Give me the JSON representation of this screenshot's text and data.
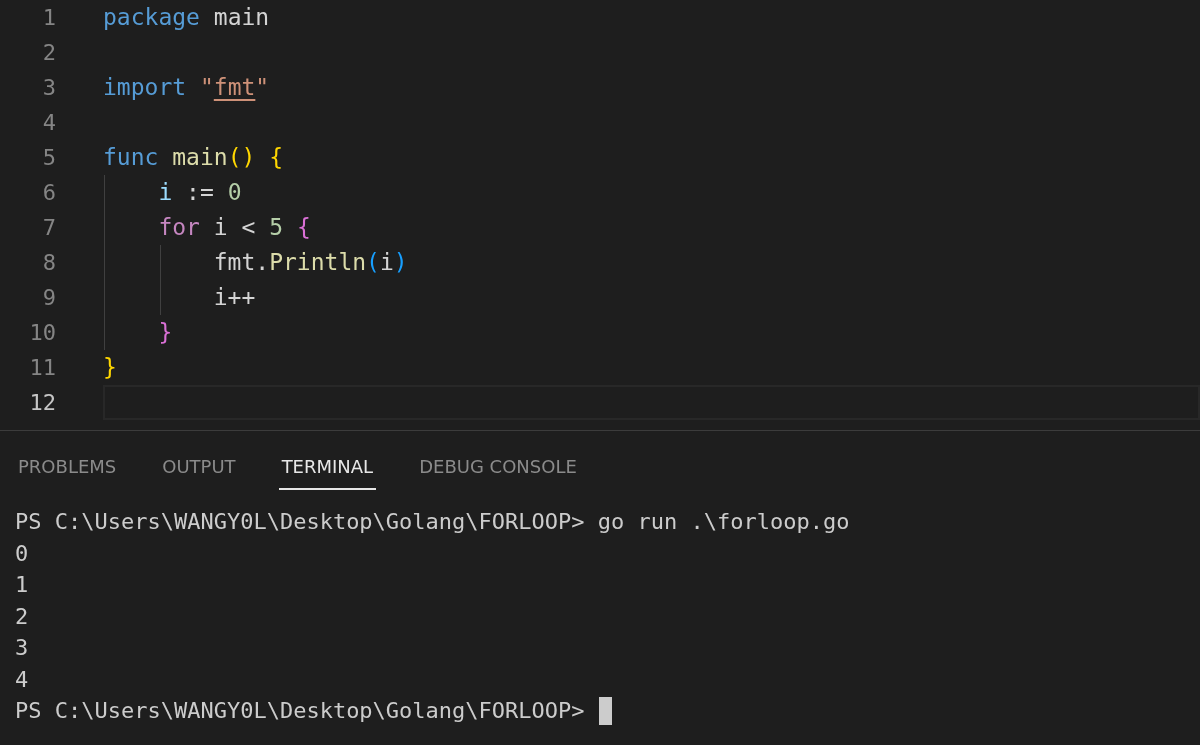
{
  "editor": {
    "lines": [
      {
        "number": "1",
        "current": false,
        "tokens": [
          {
            "text": "package",
            "kind": "keyword"
          },
          {
            "text": " main",
            "kind": "plain"
          }
        ]
      },
      {
        "number": "2",
        "current": false
      },
      {
        "number": "3",
        "current": false,
        "tokens": [
          {
            "text": "import",
            "kind": "keyword"
          },
          {
            "text": " \"",
            "kind": "string"
          },
          {
            "text": "fmt",
            "kind": "link"
          },
          {
            "text": "\"",
            "kind": "string"
          }
        ]
      },
      {
        "number": "4",
        "current": false
      },
      {
        "number": "5",
        "current": false,
        "tokens": [
          {
            "text": "func",
            "kind": "keyword"
          },
          {
            "text": " main",
            "kind": "function"
          },
          {
            "text": "() {",
            "kind": "bracket1"
          }
        ]
      },
      {
        "number": "6",
        "current": false,
        "tokens": [
          {
            "text": "    i",
            "kind": "variable"
          },
          {
            "text": " := ",
            "kind": "plain"
          },
          {
            "text": "0",
            "kind": "number"
          }
        ]
      },
      {
        "number": "7",
        "current": false,
        "tokens": [
          {
            "text": "    for",
            "kind": "control"
          },
          {
            "text": " i < ",
            "kind": "plain"
          },
          {
            "text": "5",
            "kind": "number"
          },
          {
            "text": " {",
            "kind": "bracket2"
          }
        ]
      },
      {
        "number": "8",
        "current": false,
        "tokens": [
          {
            "text": "        fmt.",
            "kind": "plain"
          },
          {
            "text": "Println",
            "kind": "function"
          },
          {
            "text": "(",
            "kind": "bracket3"
          },
          {
            "text": "i",
            "kind": "plain"
          },
          {
            "text": ")",
            "kind": "bracket3"
          }
        ]
      },
      {
        "number": "9",
        "current": false,
        "tokens": [
          {
            "text": "        i++",
            "kind": "plain"
          }
        ]
      },
      {
        "number": "10",
        "current": false,
        "tokens": [
          {
            "text": "    }",
            "kind": "bracket2"
          }
        ]
      },
      {
        "number": "11",
        "current": false,
        "tokens": [
          {
            "text": "}",
            "kind": "bracket1"
          }
        ]
      },
      {
        "number": "12",
        "current": true
      }
    ]
  },
  "panel": {
    "tabs": [
      {
        "label": "PROBLEMS",
        "selected": false
      },
      {
        "label": "OUTPUT",
        "selected": false
      },
      {
        "label": "TERMINAL",
        "selected": true
      },
      {
        "label": "DEBUG CONSOLE",
        "selected": false
      }
    ],
    "terminal": {
      "lines": [
        "PS C:\\Users\\WANGY0L\\Desktop\\Golang\\FORLOOP> go run .\\forloop.go",
        "0",
        "1",
        "2",
        "3",
        "4"
      ],
      "prompt": "PS C:\\Users\\WANGY0L\\Desktop\\Golang\\FORLOOP>"
    }
  }
}
